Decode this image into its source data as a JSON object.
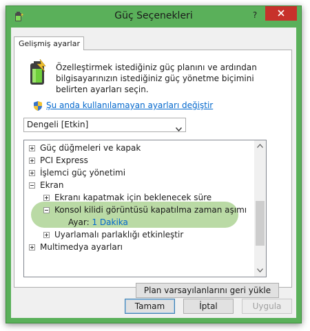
{
  "window": {
    "title": "Güç Seçenekleri",
    "help_label": "?",
    "close_icon": "close-icon",
    "app_icon": "power-options-icon"
  },
  "tab": {
    "label": "Gelişmiş ayarlar"
  },
  "panel": {
    "description": "Özelleştirmek istediğiniz güç planını ve ardından bilgisayarınızın istediğiniz güç yönetme biçimini belirten ayarları seçin.",
    "change_link": "Şu anda kullanılamayan ayarları değiştir",
    "plan_select": {
      "selected": "Dengeli [Etkin]"
    }
  },
  "tree": {
    "items": [
      {
        "label": "Güç düğmeleri ve kapak",
        "state": "+",
        "level": 0
      },
      {
        "label": "PCI Express",
        "state": "+",
        "level": 0
      },
      {
        "label": "İşlemci güç yönetimi",
        "state": "+",
        "level": 0
      },
      {
        "label": "Ekran",
        "state": "-",
        "level": 0
      },
      {
        "label": "Ekranı kapatmak için beklenecek süre",
        "state": "+",
        "level": 1
      },
      {
        "label": "Konsol kilidi görüntüsü kapatılma zaman aşımı",
        "state": "-",
        "level": 1
      },
      {
        "setting_label": "Ayar:",
        "setting_value": "1 Dakika",
        "level": 2
      },
      {
        "label": "Uyarlamalı parlaklığı etkinleştir",
        "state": "+",
        "level": 1
      },
      {
        "label": "Multimedya ayarları",
        "state": "+",
        "level": 0
      }
    ]
  },
  "buttons": {
    "restore": "Plan varsayılanlarını geri yükle",
    "ok": "Tamam",
    "cancel": "İptal",
    "apply": "Uygula"
  },
  "colors": {
    "title_bar": "#5ab05a",
    "close_button": "#c7312b",
    "highlight": "#a9d18e",
    "link": "#0066cc"
  }
}
